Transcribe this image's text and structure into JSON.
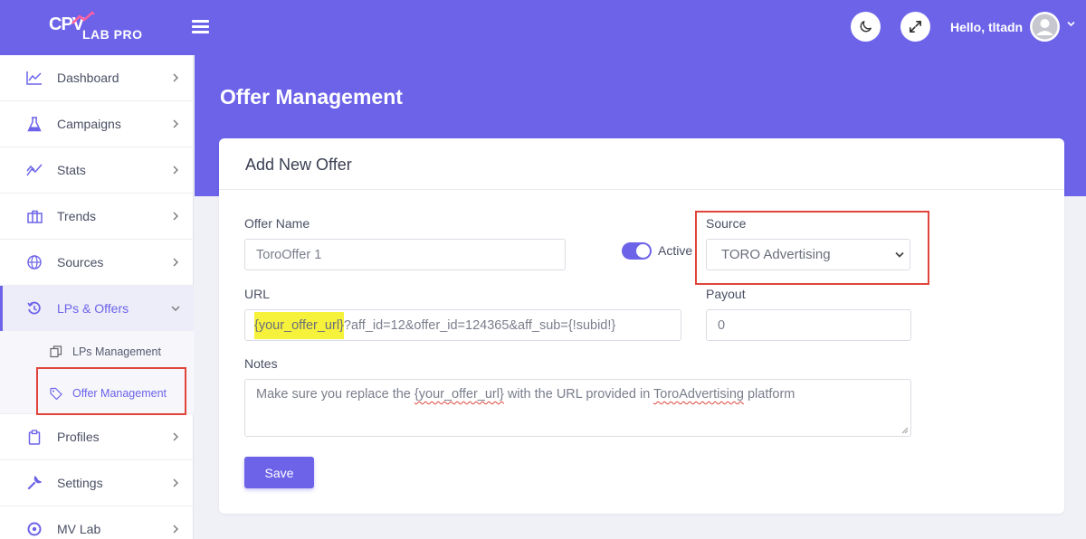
{
  "header": {
    "logo_main": "CPV",
    "logo_sub": "LAB PRO",
    "greeting": "Hello, tltadn"
  },
  "sidebar": {
    "items": [
      {
        "label": "Dashboard",
        "icon": "chart-line-icon"
      },
      {
        "label": "Campaigns",
        "icon": "flask-icon"
      },
      {
        "label": "Stats",
        "icon": "stats-icon"
      },
      {
        "label": "Trends",
        "icon": "briefcase-icon"
      },
      {
        "label": "Sources",
        "icon": "globe-icon"
      },
      {
        "label": "LPs & Offers",
        "icon": "history-icon"
      },
      {
        "label": "Profiles",
        "icon": "clipboard-icon"
      },
      {
        "label": "Settings",
        "icon": "wrench-icon"
      },
      {
        "label": "MV Lab",
        "icon": "aperture-icon"
      }
    ],
    "sub_items": [
      {
        "label": "LPs Management",
        "icon": "copy-icon"
      },
      {
        "label": "Offer Management",
        "icon": "tag-icon"
      }
    ]
  },
  "page": {
    "title": "Offer Management"
  },
  "form": {
    "card_title": "Add New Offer",
    "offer_name_label": "Offer Name",
    "offer_name_value": "ToroOffer 1",
    "active_label": "Active",
    "active": true,
    "source_label": "Source",
    "source_value": "TORO Advertising",
    "url_label": "URL",
    "url_highlight": "{your_offer_url}",
    "url_rest": "?aff_id=12&offer_id=124365&aff_sub={!subid!}",
    "payout_label": "Payout",
    "payout_value": "0",
    "notes_label": "Notes",
    "notes_part1": "Make sure you replace the ",
    "notes_token": "{your_offer_url}",
    "notes_part2": " with the URL provided in ",
    "notes_brand": "ToroAdvertising",
    "notes_part3": " platform",
    "save_label": "Save"
  },
  "colors": {
    "accent": "#6c63e9",
    "highlight": "#f6f13b",
    "annotation": "#e0443a"
  }
}
